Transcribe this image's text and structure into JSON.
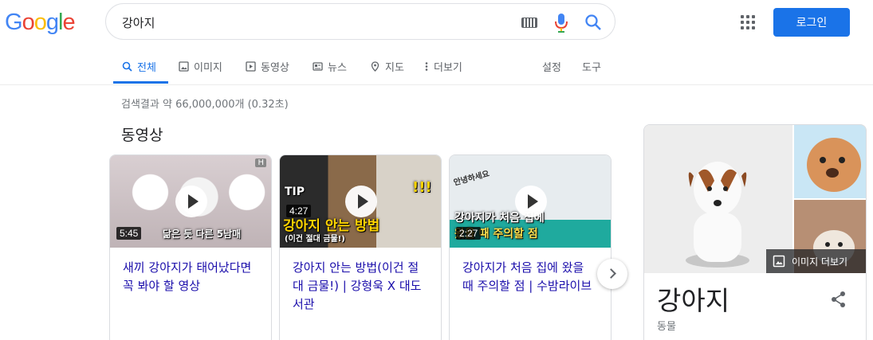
{
  "header": {
    "logo_letters": [
      {
        "char": "G",
        "color": "#4285F4"
      },
      {
        "char": "o",
        "color": "#EA4335"
      },
      {
        "char": "o",
        "color": "#FBBC05"
      },
      {
        "char": "g",
        "color": "#4285F4"
      },
      {
        "char": "l",
        "color": "#34A853"
      },
      {
        "char": "e",
        "color": "#EA4335"
      }
    ],
    "search_query": "강아지",
    "login_label": "로그인",
    "accent_color": "#1a73e8"
  },
  "tabs": {
    "all": "전체",
    "images": "이미지",
    "videos": "동영상",
    "news": "뉴스",
    "maps": "지도",
    "more": "더보기",
    "settings": "설정",
    "tools": "도구"
  },
  "result_stats": "검색결과 약 66,000,000개 (0.32초)",
  "videos_section": {
    "title": "동영상",
    "items": [
      {
        "duration": "5:45",
        "title": "새끼 강아지가 태어났다면 꼭 봐야 할 영상",
        "thumb_caption": "닮은 듯 다른 5남매",
        "thumb_badge": "H"
      },
      {
        "duration": "4:27",
        "title": "강아지 안는 방법(이건 절대 금물!) | 강형욱 X 대도서관",
        "thumb_tip": "TIP",
        "thumb_caption": "강아지 안는 방법",
        "thumb_sub": "(이건 절대 금물!)",
        "thumb_mark": "!!!"
      },
      {
        "duration": "2:27",
        "title": "강아지가 처음 집에 왔을 때 주의할 점 | 수밤라이브",
        "thumb_caption": "강아지가 처음 집에",
        "thumb_sub": "왔을 때 주의할 점",
        "thumb_hello": "안녕하세요"
      }
    ]
  },
  "knowledge_panel": {
    "title": "강아지",
    "subtitle": "동물",
    "more_images_label": "이미지 더보기"
  }
}
